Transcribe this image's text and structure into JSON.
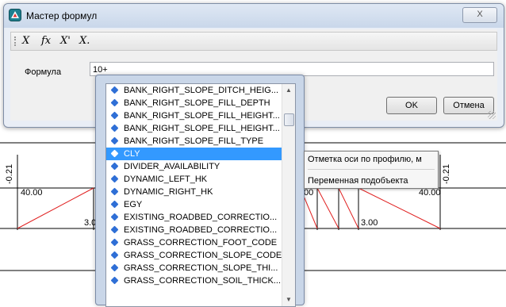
{
  "window": {
    "title": "Мастер формул",
    "close_label": "X"
  },
  "toolbar": {
    "buttons": [
      "X",
      "fx",
      "X'",
      "X."
    ]
  },
  "formula": {
    "label": "Формула",
    "value": "10+"
  },
  "buttons": {
    "ok_label": "OK",
    "cancel_label": "Отмена"
  },
  "autocomplete": {
    "items": [
      "BANK_RIGHT_SLOPE_DITCH_HEIG...",
      "BANK_RIGHT_SLOPE_FILL_DEPTH",
      "BANK_RIGHT_SLOPE_FILL_HEIGHT...",
      "BANK_RIGHT_SLOPE_FILL_HEIGHT...",
      "BANK_RIGHT_SLOPE_FILL_TYPE",
      "CLY",
      "DIVIDER_AVAILABILITY",
      "DYNAMIC_LEFT_HK",
      "DYNAMIC_RIGHT_HK",
      "EGY",
      "EXISTING_ROADBED_CORRECTIO...",
      "EXISTING_ROADBED_CORRECTIO...",
      "GRASS_CORRECTION_FOOT_CODE",
      "GRASS_CORRECTION_SLOPE_CODE",
      "GRASS_CORRECTION_SLOPE_THI...",
      "GRASS_CORRECTION_SOIL_THICK..."
    ],
    "selected_index": 5,
    "item_icon": "diamond-icon",
    "selection_color": "#3399ff"
  },
  "tooltip": {
    "description": "Отметка оси по профилю, м",
    "category": "Переменная подобъекта"
  },
  "profile": {
    "left_vertical_label": "-0.21",
    "right_vertical_label": "-0.21",
    "left_value": "40.00",
    "right_value": "40.00",
    "left_bottom_value": "3.0",
    "right_bottom_value": "3.00",
    "mid_fragment": "00"
  }
}
